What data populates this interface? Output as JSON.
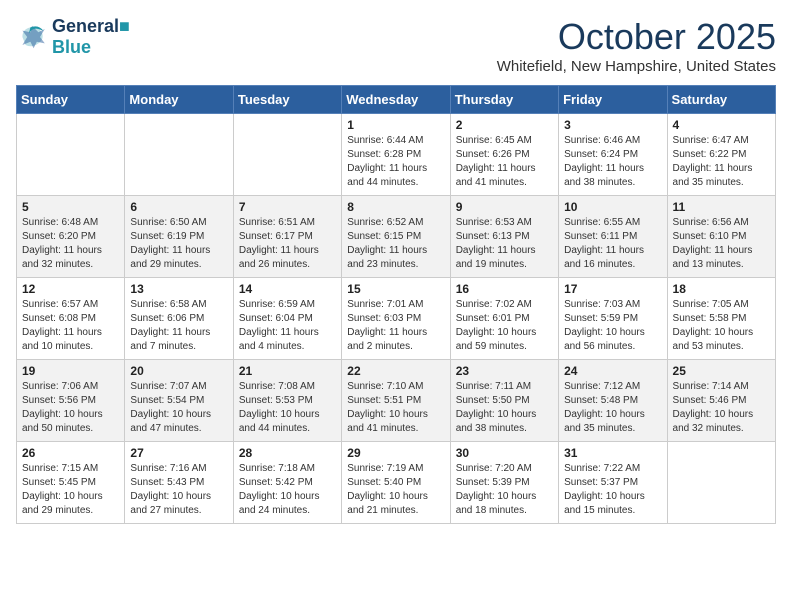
{
  "header": {
    "logo_line1": "General",
    "logo_line2": "Blue",
    "month_title": "October 2025",
    "location": "Whitefield, New Hampshire, United States"
  },
  "weekdays": [
    "Sunday",
    "Monday",
    "Tuesday",
    "Wednesday",
    "Thursday",
    "Friday",
    "Saturday"
  ],
  "weeks": [
    [
      {
        "day": "",
        "content": ""
      },
      {
        "day": "",
        "content": ""
      },
      {
        "day": "",
        "content": ""
      },
      {
        "day": "1",
        "content": "Sunrise: 6:44 AM\nSunset: 6:28 PM\nDaylight: 11 hours\nand 44 minutes."
      },
      {
        "day": "2",
        "content": "Sunrise: 6:45 AM\nSunset: 6:26 PM\nDaylight: 11 hours\nand 41 minutes."
      },
      {
        "day": "3",
        "content": "Sunrise: 6:46 AM\nSunset: 6:24 PM\nDaylight: 11 hours\nand 38 minutes."
      },
      {
        "day": "4",
        "content": "Sunrise: 6:47 AM\nSunset: 6:22 PM\nDaylight: 11 hours\nand 35 minutes."
      }
    ],
    [
      {
        "day": "5",
        "content": "Sunrise: 6:48 AM\nSunset: 6:20 PM\nDaylight: 11 hours\nand 32 minutes."
      },
      {
        "day": "6",
        "content": "Sunrise: 6:50 AM\nSunset: 6:19 PM\nDaylight: 11 hours\nand 29 minutes."
      },
      {
        "day": "7",
        "content": "Sunrise: 6:51 AM\nSunset: 6:17 PM\nDaylight: 11 hours\nand 26 minutes."
      },
      {
        "day": "8",
        "content": "Sunrise: 6:52 AM\nSunset: 6:15 PM\nDaylight: 11 hours\nand 23 minutes."
      },
      {
        "day": "9",
        "content": "Sunrise: 6:53 AM\nSunset: 6:13 PM\nDaylight: 11 hours\nand 19 minutes."
      },
      {
        "day": "10",
        "content": "Sunrise: 6:55 AM\nSunset: 6:11 PM\nDaylight: 11 hours\nand 16 minutes."
      },
      {
        "day": "11",
        "content": "Sunrise: 6:56 AM\nSunset: 6:10 PM\nDaylight: 11 hours\nand 13 minutes."
      }
    ],
    [
      {
        "day": "12",
        "content": "Sunrise: 6:57 AM\nSunset: 6:08 PM\nDaylight: 11 hours\nand 10 minutes."
      },
      {
        "day": "13",
        "content": "Sunrise: 6:58 AM\nSunset: 6:06 PM\nDaylight: 11 hours\nand 7 minutes."
      },
      {
        "day": "14",
        "content": "Sunrise: 6:59 AM\nSunset: 6:04 PM\nDaylight: 11 hours\nand 4 minutes."
      },
      {
        "day": "15",
        "content": "Sunrise: 7:01 AM\nSunset: 6:03 PM\nDaylight: 11 hours\nand 2 minutes."
      },
      {
        "day": "16",
        "content": "Sunrise: 7:02 AM\nSunset: 6:01 PM\nDaylight: 10 hours\nand 59 minutes."
      },
      {
        "day": "17",
        "content": "Sunrise: 7:03 AM\nSunset: 5:59 PM\nDaylight: 10 hours\nand 56 minutes."
      },
      {
        "day": "18",
        "content": "Sunrise: 7:05 AM\nSunset: 5:58 PM\nDaylight: 10 hours\nand 53 minutes."
      }
    ],
    [
      {
        "day": "19",
        "content": "Sunrise: 7:06 AM\nSunset: 5:56 PM\nDaylight: 10 hours\nand 50 minutes."
      },
      {
        "day": "20",
        "content": "Sunrise: 7:07 AM\nSunset: 5:54 PM\nDaylight: 10 hours\nand 47 minutes."
      },
      {
        "day": "21",
        "content": "Sunrise: 7:08 AM\nSunset: 5:53 PM\nDaylight: 10 hours\nand 44 minutes."
      },
      {
        "day": "22",
        "content": "Sunrise: 7:10 AM\nSunset: 5:51 PM\nDaylight: 10 hours\nand 41 minutes."
      },
      {
        "day": "23",
        "content": "Sunrise: 7:11 AM\nSunset: 5:50 PM\nDaylight: 10 hours\nand 38 minutes."
      },
      {
        "day": "24",
        "content": "Sunrise: 7:12 AM\nSunset: 5:48 PM\nDaylight: 10 hours\nand 35 minutes."
      },
      {
        "day": "25",
        "content": "Sunrise: 7:14 AM\nSunset: 5:46 PM\nDaylight: 10 hours\nand 32 minutes."
      }
    ],
    [
      {
        "day": "26",
        "content": "Sunrise: 7:15 AM\nSunset: 5:45 PM\nDaylight: 10 hours\nand 29 minutes."
      },
      {
        "day": "27",
        "content": "Sunrise: 7:16 AM\nSunset: 5:43 PM\nDaylight: 10 hours\nand 27 minutes."
      },
      {
        "day": "28",
        "content": "Sunrise: 7:18 AM\nSunset: 5:42 PM\nDaylight: 10 hours\nand 24 minutes."
      },
      {
        "day": "29",
        "content": "Sunrise: 7:19 AM\nSunset: 5:40 PM\nDaylight: 10 hours\nand 21 minutes."
      },
      {
        "day": "30",
        "content": "Sunrise: 7:20 AM\nSunset: 5:39 PM\nDaylight: 10 hours\nand 18 minutes."
      },
      {
        "day": "31",
        "content": "Sunrise: 7:22 AM\nSunset: 5:37 PM\nDaylight: 10 hours\nand 15 minutes."
      },
      {
        "day": "",
        "content": ""
      }
    ]
  ]
}
